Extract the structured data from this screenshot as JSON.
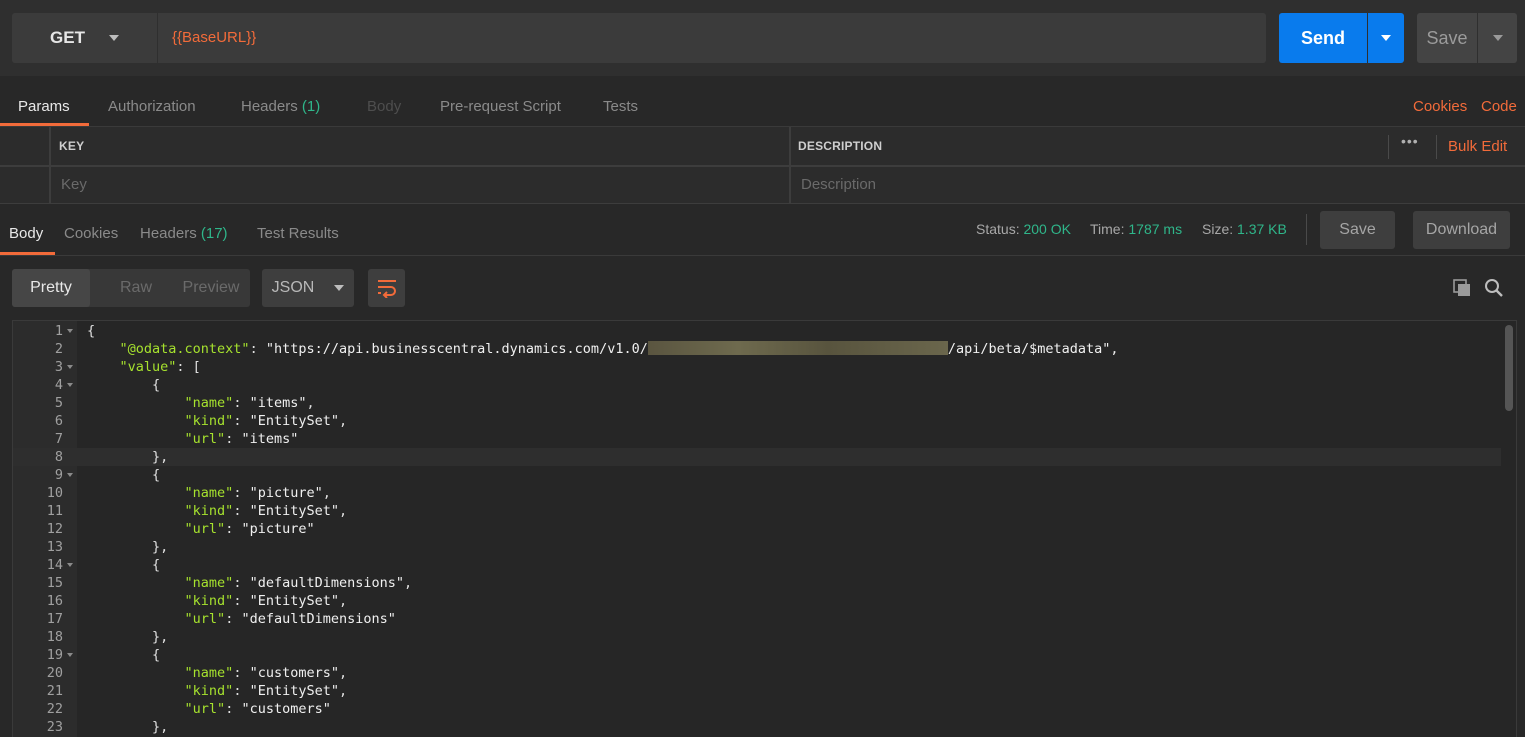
{
  "request": {
    "method": "GET",
    "url": "{{BaseURL}}",
    "send_label": "Send",
    "save_label": "Save"
  },
  "request_tabs": [
    {
      "label": "Params",
      "count": ""
    },
    {
      "label": "Authorization",
      "count": ""
    },
    {
      "label": "Headers",
      "count": "(1)"
    },
    {
      "label": "Body",
      "count": ""
    },
    {
      "label": "Pre-request Script",
      "count": ""
    },
    {
      "label": "Tests",
      "count": ""
    }
  ],
  "request_links": {
    "cookies": "Cookies",
    "code": "Code"
  },
  "params": {
    "key_header": "KEY",
    "description_header": "DESCRIPTION",
    "bulk_edit": "Bulk Edit",
    "more": "•••",
    "key_placeholder": "Key",
    "description_placeholder": "Description"
  },
  "response_tabs": [
    {
      "label": "Body",
      "count": ""
    },
    {
      "label": "Cookies",
      "count": ""
    },
    {
      "label": "Headers",
      "count": "(17)"
    },
    {
      "label": "Test Results",
      "count": ""
    }
  ],
  "response_meta": {
    "status_label": "Status:",
    "status_value": "200 OK",
    "time_label": "Time:",
    "time_value": "1787 ms",
    "size_label": "Size:",
    "size_value": "1.37 KB",
    "save_label": "Save",
    "download_label": "Download"
  },
  "view": {
    "modes": [
      "Pretty",
      "Raw",
      "Preview"
    ],
    "active_mode": "Pretty",
    "format": "JSON"
  },
  "colors": {
    "accent": "#f26b3a",
    "send": "#097bed",
    "status_ok": "#2fb68a",
    "json_key": "#a6e22e",
    "json_string": "#e6db74"
  },
  "icons": [
    "dropdown-caret-icon",
    "wrap-lines-icon",
    "copy-icon",
    "search-icon",
    "fold-arrow-icon"
  ],
  "code": {
    "lines": [
      {
        "n": "1",
        "t": "{"
      },
      {
        "n": "2",
        "k": "\"@odata.context\"",
        "pre": "\"https://api.businesscentral.dynamics.com/v1.0/",
        "post": "/api/beta/$metadata\",",
        "redacted": true
      },
      {
        "n": "3",
        "t": "    \"value\": ["
      },
      {
        "n": "4",
        "t": "        {"
      },
      {
        "n": "5",
        "t": "            \"name\": \"items\","
      },
      {
        "n": "6",
        "t": "            \"kind\": \"EntitySet\","
      },
      {
        "n": "7",
        "t": "            \"url\": \"items\""
      },
      {
        "n": "8",
        "t": "        },"
      },
      {
        "n": "9",
        "t": "        {"
      },
      {
        "n": "10",
        "t": "            \"name\": \"picture\","
      },
      {
        "n": "11",
        "t": "            \"kind\": \"EntitySet\","
      },
      {
        "n": "12",
        "t": "            \"url\": \"picture\""
      },
      {
        "n": "13",
        "t": "        },"
      },
      {
        "n": "14",
        "t": "        {"
      },
      {
        "n": "15",
        "t": "            \"name\": \"defaultDimensions\","
      },
      {
        "n": "16",
        "t": "            \"kind\": \"EntitySet\","
      },
      {
        "n": "17",
        "t": "            \"url\": \"defaultDimensions\""
      },
      {
        "n": "18",
        "t": "        },"
      },
      {
        "n": "19",
        "t": "        {"
      },
      {
        "n": "20",
        "t": "            \"name\": \"customers\","
      },
      {
        "n": "21",
        "t": "            \"kind\": \"EntitySet\","
      },
      {
        "n": "22",
        "t": "            \"url\": \"customers\""
      },
      {
        "n": "23",
        "t": "        },"
      }
    ]
  }
}
